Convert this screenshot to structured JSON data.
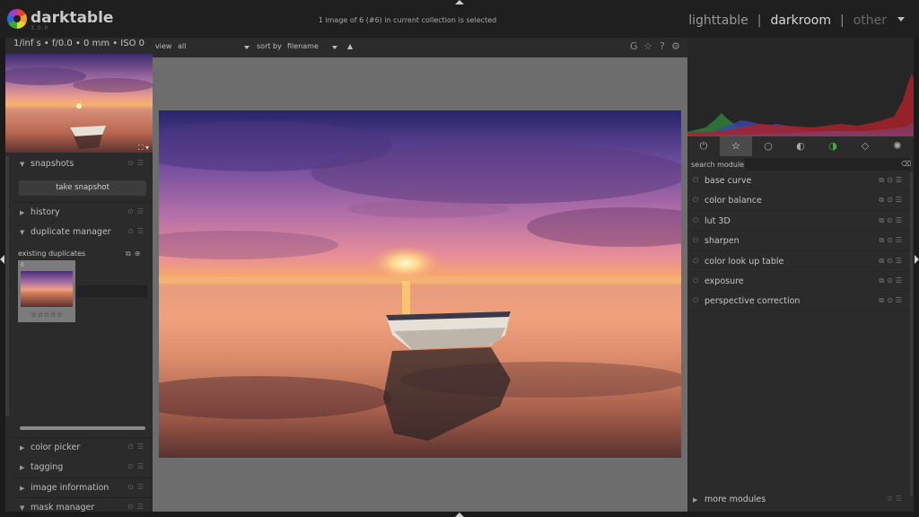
{
  "app": {
    "name": "darktable",
    "version": "3.0.0"
  },
  "header": {
    "collection_status": "1 image of 6 (#6) in current collection is selected",
    "views": [
      {
        "label": "lighttable",
        "state": "normal"
      },
      {
        "label": "darkroom",
        "state": "active"
      },
      {
        "label": "other",
        "state": "dim"
      }
    ],
    "separator": "|"
  },
  "left_panel": {
    "exif": "1/inf s • f/0.0 • 0 mm • ISO 0",
    "modules": {
      "snapshots": "snapshots",
      "history": "history",
      "duplicate_manager": "duplicate manager",
      "color_picker": "color picker",
      "tagging": "tagging",
      "image_information": "image information",
      "mask_manager": "mask manager"
    },
    "take_snapshot": "take snapshot",
    "existing_duplicates": "existing duplicates",
    "duplicate_version": "0",
    "duplicate_stars": "☆☆☆☆☆"
  },
  "center": {
    "view_label": "view",
    "view_value": "all",
    "sort_label": "sort by",
    "sort_value": "filename",
    "sort_dir": "▲",
    "icons": [
      "grouping-icon",
      "star-icon",
      "help-icon",
      "gear-icon"
    ]
  },
  "right_panel": {
    "search_label": "search module",
    "search_value": "",
    "modules": [
      "base curve",
      "color balance",
      "lut 3D",
      "sharpen",
      "color look up table",
      "exposure",
      "perspective correction"
    ],
    "more_modules": "more modules",
    "groups": [
      "power-icon",
      "star-icon",
      "circle-icon",
      "halftone-icon",
      "color-icon",
      "correct-icon",
      "effect-icon"
    ]
  }
}
